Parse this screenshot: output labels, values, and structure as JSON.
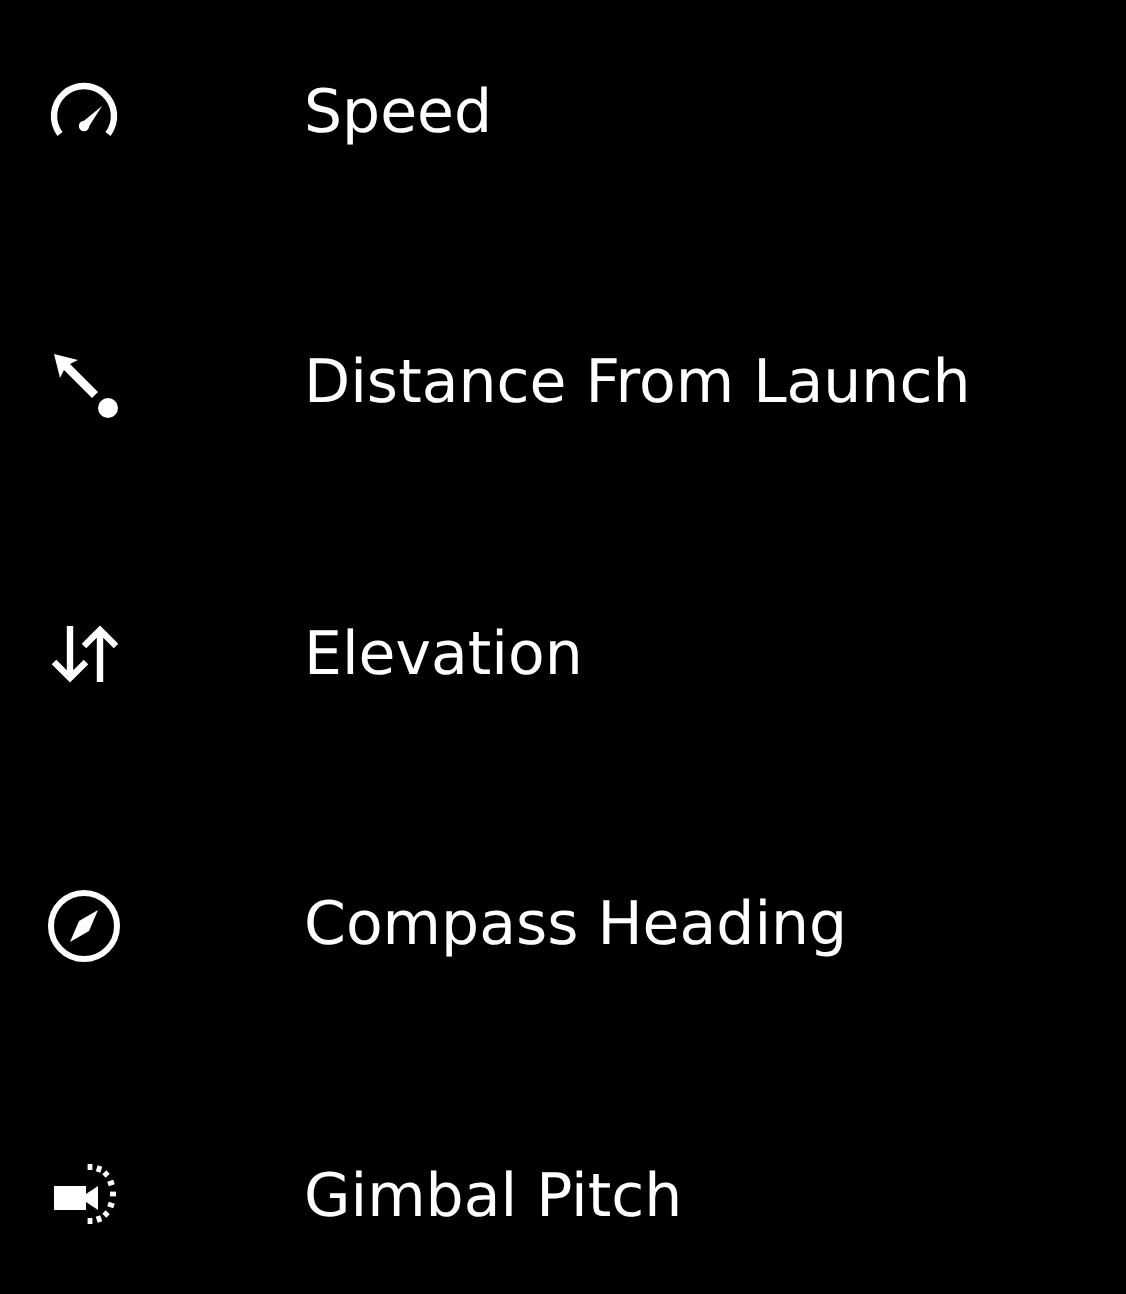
{
  "items": [
    {
      "kind": "speed",
      "label": "Speed"
    },
    {
      "kind": "distance",
      "label": "Distance From Launch"
    },
    {
      "kind": "elevation",
      "label": "Elevation"
    },
    {
      "kind": "compass",
      "label": "Compass Heading"
    },
    {
      "kind": "gimbal",
      "label": "Gimbal Pitch"
    }
  ]
}
